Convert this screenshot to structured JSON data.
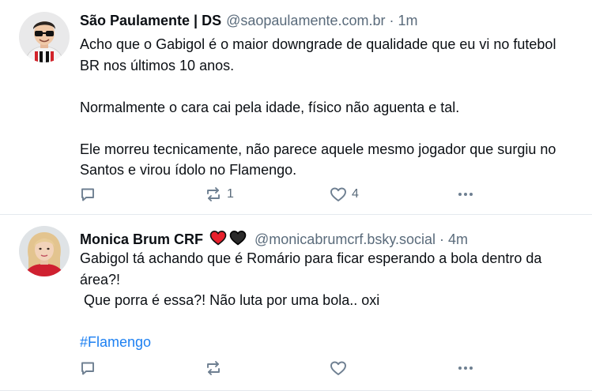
{
  "posts": [
    {
      "author": {
        "name": "São Paulamente | DS",
        "handle": "@saopaulamente.com.br",
        "time": "1m",
        "avatar": "avatar-man-sunglasses-spfc-shirt"
      },
      "text": {
        "para1": "Acho que o Gabigol é o maior downgrade de qualidade que eu vi no futebol BR nos últimos 10 anos.",
        "para2": "Normalmente o cara cai pela idade, físico não aguenta e tal.",
        "para3": "Ele morreu tecnicamente, não parece aquele mesmo jogador que surgiu no Santos e virou ídolo no Flamengo."
      },
      "actions": {
        "reply_icon": "reply-icon",
        "repost_icon": "repost-icon",
        "repost_count": "1",
        "like_icon": "heart-icon",
        "like_count": "4",
        "more_icon": "more-icon"
      }
    },
    {
      "author": {
        "name": "Monica Brum CRF",
        "name_emojis": [
          "red-heart",
          "black-heart"
        ],
        "handle": "@monicabrumcrf.bsky.social",
        "time": "4m",
        "avatar": "avatar-woman-blonde"
      },
      "text": {
        "para1": "Gabigol tá achando que é Romário para ficar esperando a bola dentro da área?!",
        "para2": " Que porra é essa?! Não luta por uma bola.. oxi",
        "hashtag": "#Flamengo"
      },
      "actions": {
        "reply_icon": "reply-icon",
        "repost_icon": "repost-icon",
        "repost_count": "",
        "like_icon": "heart-icon",
        "like_count": "",
        "more_icon": "more-icon"
      }
    }
  ],
  "colors": {
    "text": "#0b0f14",
    "muted": "#5a6b7b",
    "icon": "#6e7f91",
    "link": "#1d80f2",
    "divider": "#e5e9ee",
    "red_heart": "#e8202c"
  }
}
